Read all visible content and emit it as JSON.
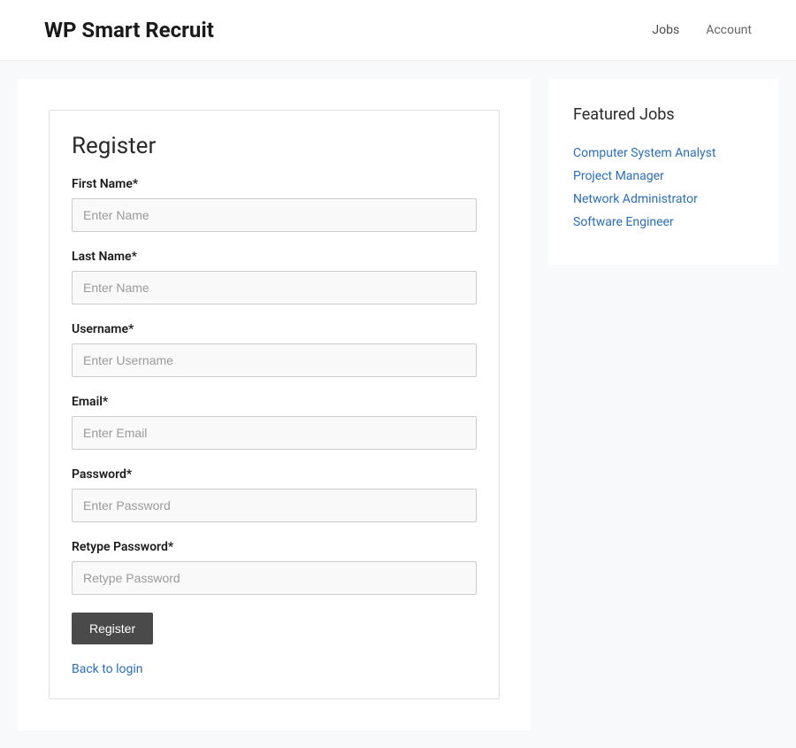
{
  "header": {
    "site_title": "WP Smart Recruit",
    "nav": [
      {
        "label": "Jobs"
      },
      {
        "label": "Account"
      }
    ]
  },
  "form": {
    "title": "Register",
    "fields": {
      "first_name": {
        "label": "First Name*",
        "placeholder": "Enter Name"
      },
      "last_name": {
        "label": "Last Name*",
        "placeholder": "Enter Name"
      },
      "username": {
        "label": "Username*",
        "placeholder": "Enter Username"
      },
      "email": {
        "label": "Email*",
        "placeholder": "Enter Email"
      },
      "password": {
        "label": "Password*",
        "placeholder": "Enter Password"
      },
      "retype_password": {
        "label": "Retype Password*",
        "placeholder": "Retype Password"
      }
    },
    "submit_label": "Register",
    "back_link_label": "Back to login"
  },
  "sidebar": {
    "title": "Featured Jobs",
    "jobs": [
      {
        "label": "Computer System Analyst"
      },
      {
        "label": "Project Manager"
      },
      {
        "label": "Network Administrator"
      },
      {
        "label": "Software Engineer"
      }
    ]
  }
}
